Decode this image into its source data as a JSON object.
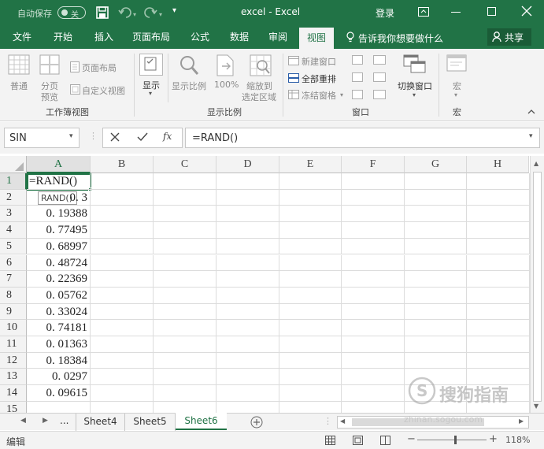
{
  "titlebar": {
    "autosave_label": "自动保存",
    "autosave_state": "关",
    "title": "excel  -  Excel",
    "login_label": "登录"
  },
  "tabs": [
    "文件",
    "开始",
    "插入",
    "页面布局",
    "公式",
    "数据",
    "审阅",
    "视图"
  ],
  "active_tab": "视图",
  "tell_me": "告诉我你想要做什么",
  "share": "共享",
  "ribbon": {
    "workbook_views": {
      "label": "工作簿视图",
      "normal": "普通",
      "page_break_line1": "分页",
      "page_break_line2": "预览",
      "page_layout": "页面布局",
      "custom_views": "自定义视图"
    },
    "show": {
      "label": "显示"
    },
    "zoom": {
      "label": "显示比例",
      "zoom": "显示比例",
      "hundred": "100%",
      "to_selection_line1": "缩放到",
      "to_selection_line2": "选定区域"
    },
    "window": {
      "label": "窗口",
      "new_window": "新建窗口",
      "arrange_all": "全部重排",
      "freeze_panes": "冻结窗格",
      "switch_windows": "切换窗口"
    },
    "macros": {
      "label": "宏",
      "macro": "宏"
    }
  },
  "formula_bar": {
    "name_box": "SIN",
    "formula": "=RAND()"
  },
  "grid": {
    "columns": [
      "A",
      "B",
      "C",
      "D",
      "E",
      "F",
      "G",
      "H"
    ],
    "rows": [
      "1",
      "2",
      "3",
      "4",
      "5",
      "6",
      "7",
      "8",
      "9",
      "10",
      "11",
      "12",
      "13",
      "14",
      "15"
    ],
    "a_values": [
      "=RAND()",
      "0.  3",
      "0. 19388",
      "0. 77495",
      "0. 68997",
      "0. 48724",
      "0. 22369",
      "0. 05762",
      "0. 33024",
      "0. 74181",
      "0. 01363",
      "0. 18384",
      "0. 0297",
      "0. 09615",
      ""
    ],
    "tooltip": "RAND()"
  },
  "sheets": {
    "ellipsis": "...",
    "tabs": [
      "Sheet4",
      "Sheet5",
      "Sheet6"
    ],
    "active": "Sheet6"
  },
  "status": {
    "mode": "编辑",
    "zoom": "118%"
  },
  "watermark": {
    "line1": "搜狗指南",
    "line2": "zhinan.sogou.com"
  },
  "colors": {
    "brand": "#217346",
    "ribbon_bg": "#f3f3f3"
  }
}
